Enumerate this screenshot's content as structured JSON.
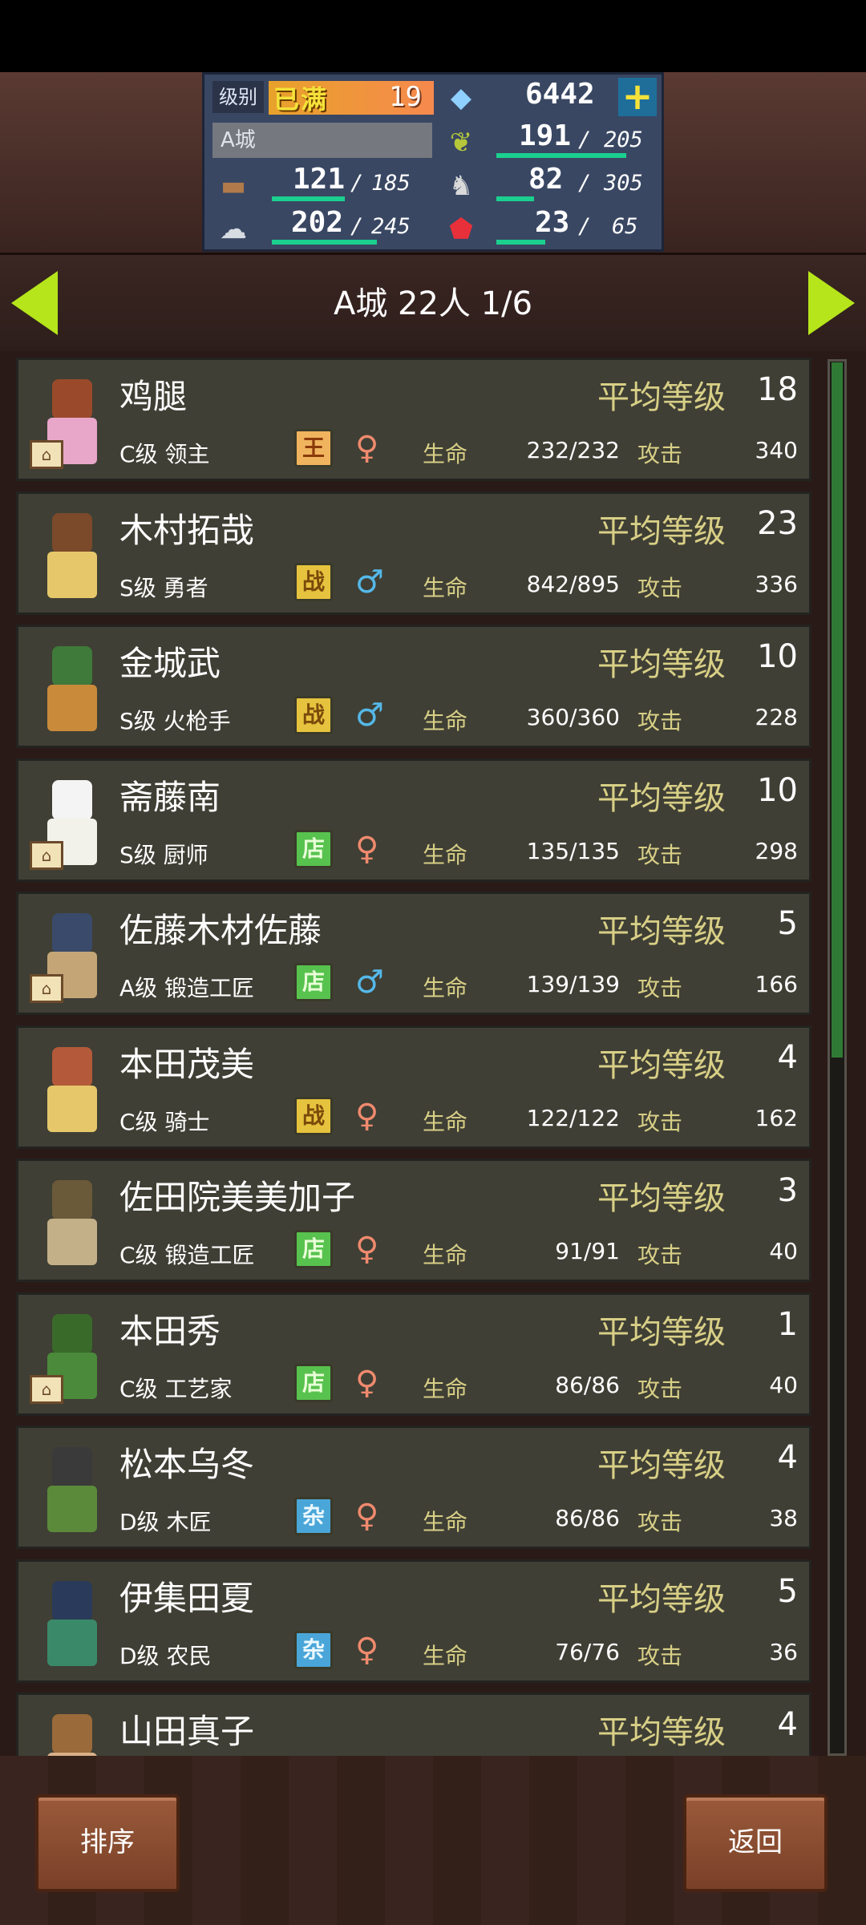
{
  "resources": {
    "level_label": "级别",
    "level_status": "已满",
    "level_value": "19",
    "gems": "6442",
    "plus_symbol": "+",
    "city_name": "A城",
    "grass_value": "191",
    "grass_max": "205",
    "wood_value": "121",
    "wood_max": "185",
    "food_value": "82",
    "food_max": "305",
    "ore_value": "202",
    "ore_max": "245",
    "ruby_value": "23",
    "ruby_max": "65",
    "separator": "/",
    "grass_fraction": 0.93,
    "wood_fraction": 0.65,
    "food_fraction": 0.27,
    "ore_fraction": 0.82,
    "ruby_fraction": 0.35
  },
  "header": {
    "title": "A城  22人 1/6"
  },
  "labels": {
    "avg_level": "平均等级",
    "life": "生命",
    "attack": "攻击"
  },
  "characters": [
    {
      "name": "鸡腿",
      "class": "C级 领主",
      "badge": "王",
      "badge_type": "king",
      "gender": "female",
      "level": "18",
      "hp": "232/232",
      "atk": "340",
      "house": true,
      "hair": "#9a4a2a",
      "outfit": "#e8a6c8"
    },
    {
      "name": "木村拓哉",
      "class": "S级 勇者",
      "badge": "战",
      "badge_type": "war",
      "gender": "male",
      "level": "23",
      "hp": "842/895",
      "atk": "336",
      "house": false,
      "hair": "#7a4a2a",
      "outfit": "#e6c86a"
    },
    {
      "name": "金城武",
      "class": "S级 火枪手",
      "badge": "战",
      "badge_type": "war",
      "gender": "male",
      "level": "10",
      "hp": "360/360",
      "atk": "228",
      "house": false,
      "hair": "#3f7a3a",
      "outfit": "#c98a3a"
    },
    {
      "name": "斋藤南",
      "class": "S级 厨师",
      "badge": "店",
      "badge_type": "shop",
      "gender": "female",
      "level": "10",
      "hp": "135/135",
      "atk": "298",
      "house": true,
      "hair": "#f4f4f4",
      "outfit": "#f2f2ea"
    },
    {
      "name": "佐藤木材佐藤",
      "class": "A级 锻造工匠",
      "badge": "店",
      "badge_type": "shop",
      "gender": "male",
      "level": "5",
      "hp": "139/139",
      "atk": "166",
      "house": true,
      "hair": "#3a4a6a",
      "outfit": "#c4a676"
    },
    {
      "name": "本田茂美",
      "class": "C级 骑士",
      "badge": "战",
      "badge_type": "war",
      "gender": "female",
      "level": "4",
      "hp": "122/122",
      "atk": "162",
      "house": false,
      "hair": "#b45a3a",
      "outfit": "#e6c86a"
    },
    {
      "name": "佐田院美美加子",
      "class": "C级 锻造工匠",
      "badge": "店",
      "badge_type": "shop",
      "gender": "female",
      "level": "3",
      "hp": "91/91",
      "atk": "40",
      "house": false,
      "hair": "#6a5a3a",
      "outfit": "#c4b088"
    },
    {
      "name": "本田秀",
      "class": "C级 工艺家",
      "badge": "店",
      "badge_type": "shop",
      "gender": "female",
      "level": "1",
      "hp": "86/86",
      "atk": "40",
      "house": true,
      "hair": "#3a6a2a",
      "outfit": "#4a8a3a"
    },
    {
      "name": "松本乌冬",
      "class": "D级 木匠",
      "badge": "杂",
      "badge_type": "misc",
      "gender": "female",
      "level": "4",
      "hp": "86/86",
      "atk": "38",
      "house": false,
      "hair": "#3a3a3a",
      "outfit": "#5a8a3a"
    },
    {
      "name": "伊集田夏",
      "class": "D级 农民",
      "badge": "杂",
      "badge_type": "misc",
      "gender": "female",
      "level": "5",
      "hp": "76/76",
      "atk": "36",
      "house": false,
      "hair": "#2a3a5a",
      "outfit": "#3a8a6a"
    },
    {
      "name": "山田真子",
      "class": "",
      "badge": "",
      "badge_type": "",
      "gender": "",
      "level": "4",
      "hp": "",
      "atk": "",
      "house": false,
      "hair": "#9a6a3a",
      "outfit": "#d8b088"
    }
  ],
  "scroll_fraction": 0.5,
  "buttons": {
    "sort": "排序",
    "back": "返回"
  }
}
